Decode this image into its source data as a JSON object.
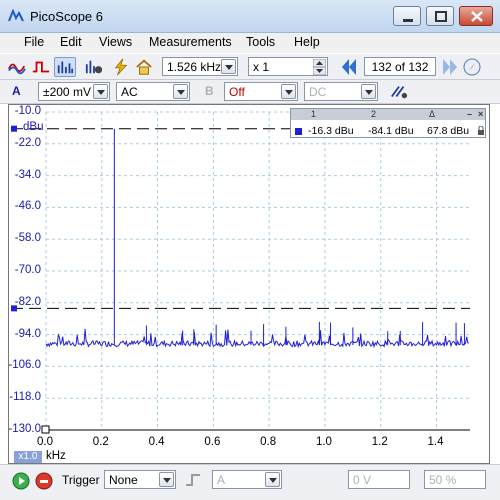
{
  "window": {
    "title": "PicoScope 6",
    "colors": {
      "titlebar": "#c9dbf1",
      "trace": "#1f1fd6",
      "axis_text": "#1a1ab0",
      "close": "#c94a33"
    }
  },
  "menu": {
    "file": "File",
    "edit": "Edit",
    "views": "Views",
    "measurements": "Measurements",
    "tools": "Tools",
    "help": "Help"
  },
  "toolbar": {
    "frequency": "1.526 kHz",
    "zoom": "x 1",
    "buffer_current": "132",
    "buffer_of": "of 132",
    "icons": [
      "scope-mode-icon",
      "persistence-mode-icon",
      "spectrum-mode-icon",
      "channel-options-icon",
      "auto-setup-icon",
      "home-icon"
    ]
  },
  "channel": {
    "a_label": "A",
    "range": "±200 mV",
    "coupling": "AC",
    "b_label": "B",
    "b_range": "Off",
    "b_coupling": "DC"
  },
  "rulers": {
    "col1": "1",
    "col2": "2",
    "col3": "Δ",
    "val1": "-16.3 dBu",
    "val2": "-84.1 dBu",
    "delta": "67.8 dBu"
  },
  "axis": {
    "yunit": "dBu",
    "y_ticks": [
      "-10.0",
      "-22.0",
      "-34.0",
      "-46.0",
      "-58.0",
      "-70.0",
      "-82.0",
      "-94.0",
      "-106.0",
      "-118.0",
      "-130.0"
    ],
    "x_ticks": [
      "0.0",
      "0.2",
      "0.4",
      "0.6",
      "0.8",
      "1.0",
      "1.2",
      "1.4"
    ],
    "xunit": "kHz",
    "zoom_badge": "x1.0"
  },
  "status": {
    "trigger_label": "Trigger",
    "trigger_mode": "None",
    "trigger_source": "A",
    "threshold": "0 V",
    "pretrigger": "50 %"
  },
  "chart_data": {
    "type": "line",
    "title": "",
    "xlabel": "kHz",
    "ylabel": "dBu",
    "xlim": [
      0.0,
      1.52
    ],
    "ylim": [
      -130.0,
      -10.0
    ],
    "grid": true,
    "series": [
      {
        "values": [
          {
            "x": 0.0,
            "y": -98
          },
          {
            "x": 0.1,
            "y": -98
          },
          {
            "x": 0.2,
            "y": -98
          },
          {
            "x": 0.245,
            "y": -16.3
          },
          {
            "x": 0.26,
            "y": -98
          },
          {
            "x": 0.49,
            "y": -92
          },
          {
            "x": 0.6,
            "y": -98
          },
          {
            "x": 0.735,
            "y": -92
          },
          {
            "x": 0.9,
            "y": -98
          },
          {
            "x": 0.98,
            "y": -93
          },
          {
            "x": 1.1,
            "y": -98
          },
          {
            "x": 1.225,
            "y": -94
          },
          {
            "x": 1.35,
            "y": -98
          },
          {
            "x": 1.47,
            "y": -95
          },
          {
            "x": 1.52,
            "y": -98
          }
        ]
      }
    ],
    "cursors_y": [
      -16.3,
      -84.1
    ]
  }
}
